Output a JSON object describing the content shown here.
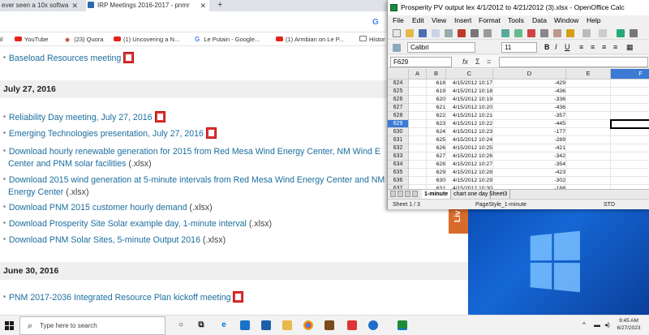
{
  "browser": {
    "tabs": [
      {
        "title": "ever seen a 10x softwa",
        "active": false
      },
      {
        "title": "IRP Meetings 2016-2017 - pnmr",
        "active": true
      }
    ],
    "new_tab": "+",
    "search_icon": "G",
    "bookmarks": [
      {
        "label": "il",
        "icon": "folder-icon"
      },
      {
        "label": "YouTube",
        "icon": "youtube-icon"
      },
      {
        "label": "(23) Quora",
        "icon": "quora-icon"
      },
      {
        "label": "(1) Uncovering a N...",
        "icon": "youtube-icon"
      },
      {
        "label": "Le Putain - Google...",
        "icon": "google-icon"
      },
      {
        "label": "(1) Armbian on Le P...",
        "icon": "youtube-icon"
      },
      {
        "label": "Histor",
        "icon": "folder-icon"
      }
    ]
  },
  "page": {
    "top_item": "Baseload Resources meeting",
    "section1_date": "July 27, 2016",
    "section1_items": [
      {
        "text": "Reliability Day meeting, July 27, 2016",
        "suffix": "",
        "pdf": true
      },
      {
        "text": "Emerging Technologies presentation, July 27, 2016",
        "suffix": "",
        "pdf": true
      },
      {
        "text": "Download hourly renewable generation for 2015 from Red Mesa Wind Energy Center, NM Wind E",
        "suffix": "",
        "pdf": false
      },
      {
        "text": "Center and PNM solar facilities",
        "suffix": " (.xlsx)",
        "pdf": false
      },
      {
        "text": "Download 2015 wind generation at 5-minute intervals from Red Mesa Wind Energy Center and NM",
        "suffix": "",
        "pdf": false
      },
      {
        "text": "Energy Center",
        "suffix": " (.xlsx)",
        "pdf": false
      },
      {
        "text": "Download PNM 2015 customer hourly demand",
        "suffix": " (.xlsx)",
        "pdf": false
      },
      {
        "text": "Download Prosperity Site Solar example day, 1-minute interval",
        "suffix": " (.xlsx)",
        "pdf": false
      },
      {
        "text": "Download PNM Solar Sites, 5-minute Output 2016",
        "suffix": " (.xlsx)",
        "pdf": false
      }
    ],
    "section2_date": "June 30, 2016",
    "section2_items": [
      {
        "text": "PNM 2017-2036 Integrated Resource Plan kickoff meeting",
        "suffix": "",
        "pdf": true
      }
    ]
  },
  "calc": {
    "title": "Prosperity PV output lex 4/1/2012 to 4/21/2012 (3).xlsx - OpenOffice Calc",
    "menus": [
      "File",
      "Edit",
      "View",
      "Insert",
      "Format",
      "Tools",
      "Data",
      "Window",
      "Help"
    ],
    "font_name": "Calibri",
    "font_size": "11",
    "format_buttons": [
      "B",
      "I",
      "U"
    ],
    "cell_ref": "F629",
    "fx_symbols": [
      "fx",
      "Σ",
      "="
    ],
    "columns": [
      "A",
      "B",
      "C",
      "D",
      "E",
      "F"
    ],
    "selected_column": "F",
    "selected_row": "629",
    "rows": [
      {
        "row": "624",
        "b": "618",
        "c": "4/15/2012 10:17",
        "d": "-429"
      },
      {
        "row": "625",
        "b": "619",
        "c": "4/15/2012 10:18",
        "d": "-436"
      },
      {
        "row": "626",
        "b": "620",
        "c": "4/15/2012 10:19",
        "d": "-336"
      },
      {
        "row": "627",
        "b": "621",
        "c": "4/15/2012 10:20",
        "d": "-436"
      },
      {
        "row": "628",
        "b": "622",
        "c": "4/15/2012 10:21",
        "d": "-357"
      },
      {
        "row": "629",
        "b": "623",
        "c": "4/15/2012 10:22",
        "d": "-445"
      },
      {
        "row": "630",
        "b": "624",
        "c": "4/15/2012 10:23",
        "d": "-177"
      },
      {
        "row": "631",
        "b": "625",
        "c": "4/15/2012 10:24",
        "d": "-289"
      },
      {
        "row": "632",
        "b": "626",
        "c": "4/15/2012 10:25",
        "d": "-421"
      },
      {
        "row": "633",
        "b": "627",
        "c": "4/15/2012 10:26",
        "d": "-342"
      },
      {
        "row": "634",
        "b": "628",
        "c": "4/15/2012 10:27",
        "d": "-354"
      },
      {
        "row": "635",
        "b": "629",
        "c": "4/15/2012 10:28",
        "d": "-423"
      },
      {
        "row": "636",
        "b": "630",
        "c": "4/15/2012 10:29",
        "d": "-302"
      },
      {
        "row": "637",
        "b": "631",
        "c": "4/15/2012 10:30",
        "d": "-188"
      }
    ],
    "sheet_tabs": [
      "1-minute",
      "chart one day",
      "Sheet3"
    ],
    "active_sheet": "1-minute",
    "status_sheet": "Sheet 1 / 3",
    "status_style": "PageStyle_1-minute",
    "status_mode": "STD"
  },
  "side_tab_label": "Liv",
  "taskbar": {
    "search_placeholder": "Type here to search",
    "time": "9:45 AM",
    "date": "6/27/2023",
    "accent": "#0078d7"
  }
}
